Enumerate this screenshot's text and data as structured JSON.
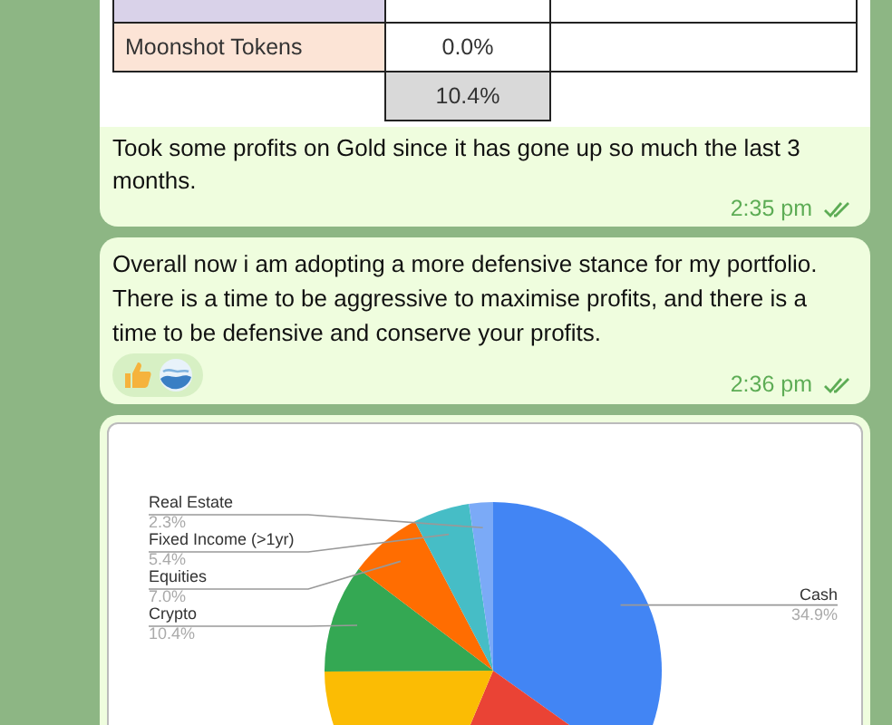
{
  "messages": [
    {
      "kind": "table",
      "table": {
        "rows": [
          {
            "cut": true,
            "color": "#d9d2e9"
          },
          {
            "cut": false,
            "cells": [
              "Moonshot Tokens",
              "0.0%"
            ],
            "color": "#fce4d6"
          }
        ],
        "total": "10.4%"
      },
      "text": "Took some profits on Gold since it has gone up so much the last 3 months.",
      "time": "2:35 pm",
      "read": true
    },
    {
      "kind": "text",
      "text": "Overall now i am adopting a more defensive stance for my portfolio. There is a time to be aggressive to maximise profits, and there is a time to be defensive and conserve your profits.",
      "reactions": true,
      "time": "2:36 pm",
      "read": true
    },
    {
      "kind": "chart",
      "chart_data": {
        "type": "pie",
        "categories": [
          "Cash",
          null,
          null,
          "Crypto",
          "Equities",
          "Fixed Income (>1yr)",
          "Real Estate"
        ],
        "values": [
          34.9,
          21.5,
          18.6,
          10.4,
          7.0,
          5.4,
          2.3
        ],
        "colors": [
          "#4285f4",
          "#ea4335",
          "#fbbc04",
          "#34a853",
          "#ff6d01",
          "#46bdc6",
          "#7baaf7"
        ],
        "value_labels": [
          "34.9%",
          null,
          null,
          "10.4%",
          "7.0%",
          "5.4%",
          "2.3%"
        ]
      }
    }
  ]
}
